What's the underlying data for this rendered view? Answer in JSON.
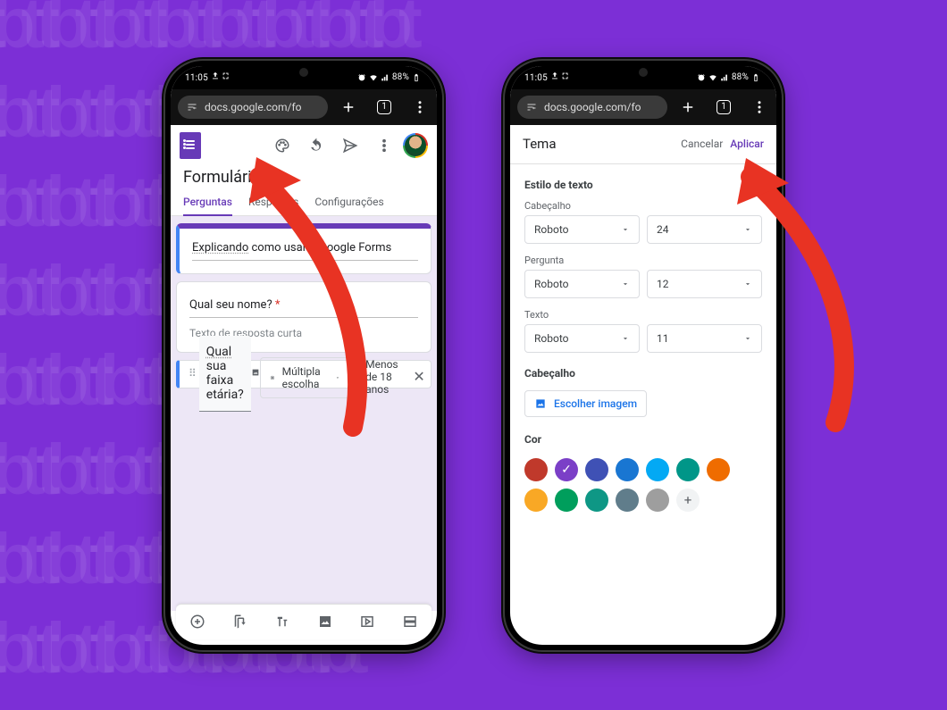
{
  "status": {
    "time": "11:05",
    "battery": "88%",
    "tab_count": "1"
  },
  "browser": {
    "url": "docs.google.com/fo"
  },
  "left": {
    "title": "Formulári",
    "tabs": {
      "questions": "Perguntas",
      "answers": "Respostas",
      "settings": "Configurações"
    },
    "topcard": {
      "pre": "Explicando",
      "rest": " como usar o Google Forms"
    },
    "q1": {
      "title": "Qual seu nome? ",
      "placeholder": "Texto de resposta curta"
    },
    "q2": {
      "pre": "Qual",
      "rest": " sua faixa etária?"
    },
    "qtype_label": "Múltipla escolha",
    "opt1": "Menos de 18 anos"
  },
  "right": {
    "title": "Tema",
    "cancel": "Cancelar",
    "apply": "Aplicar",
    "text_style": "Estilo de texto",
    "hdr": "Cabeçalho",
    "question": "Pergunta",
    "text": "Texto",
    "font": "Roboto",
    "size_hdr": "24",
    "size_q": "12",
    "size_t": "11",
    "header_section": "Cabeçalho",
    "choose_img": "Escolher imagem",
    "color_section": "Cor",
    "colors": [
      "#c0392b",
      "#7b3fc7",
      "#3f51b5",
      "#1976d2",
      "#03a9f4",
      "#009688",
      "#ef6c00",
      "#f9a825",
      "#009e5c",
      "#0e9785",
      "#607d8b",
      "#9e9e9e"
    ],
    "selected_color": 1
  }
}
